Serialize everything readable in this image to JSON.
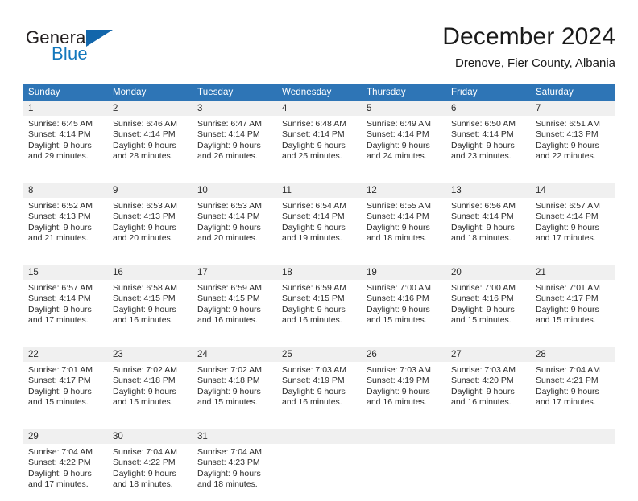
{
  "logo": {
    "text_top": "General",
    "text_bottom": "Blue",
    "triangle_icon": "blue-triangle-icon",
    "color_top": "#231f20",
    "color_bottom": "#1277bc",
    "color_triangle": "#1266ab"
  },
  "header": {
    "title": "December 2024",
    "subtitle": "Drenove, Fier County, Albania"
  },
  "theme": {
    "header_bg": "#2e75b6",
    "header_text": "#ffffff",
    "daynum_bg": "#f0f0f0",
    "row_divider": "#2e75b6",
    "body_text": "#2b2b2b"
  },
  "columns": [
    "Sunday",
    "Monday",
    "Tuesday",
    "Wednesday",
    "Thursday",
    "Friday",
    "Saturday"
  ],
  "weeks": [
    [
      {
        "day": "1",
        "sunrise": "Sunrise: 6:45 AM",
        "sunset": "Sunset: 4:14 PM",
        "daylight1": "Daylight: 9 hours",
        "daylight2": "and 29 minutes."
      },
      {
        "day": "2",
        "sunrise": "Sunrise: 6:46 AM",
        "sunset": "Sunset: 4:14 PM",
        "daylight1": "Daylight: 9 hours",
        "daylight2": "and 28 minutes."
      },
      {
        "day": "3",
        "sunrise": "Sunrise: 6:47 AM",
        "sunset": "Sunset: 4:14 PM",
        "daylight1": "Daylight: 9 hours",
        "daylight2": "and 26 minutes."
      },
      {
        "day": "4",
        "sunrise": "Sunrise: 6:48 AM",
        "sunset": "Sunset: 4:14 PM",
        "daylight1": "Daylight: 9 hours",
        "daylight2": "and 25 minutes."
      },
      {
        "day": "5",
        "sunrise": "Sunrise: 6:49 AM",
        "sunset": "Sunset: 4:14 PM",
        "daylight1": "Daylight: 9 hours",
        "daylight2": "and 24 minutes."
      },
      {
        "day": "6",
        "sunrise": "Sunrise: 6:50 AM",
        "sunset": "Sunset: 4:14 PM",
        "daylight1": "Daylight: 9 hours",
        "daylight2": "and 23 minutes."
      },
      {
        "day": "7",
        "sunrise": "Sunrise: 6:51 AM",
        "sunset": "Sunset: 4:13 PM",
        "daylight1": "Daylight: 9 hours",
        "daylight2": "and 22 minutes."
      }
    ],
    [
      {
        "day": "8",
        "sunrise": "Sunrise: 6:52 AM",
        "sunset": "Sunset: 4:13 PM",
        "daylight1": "Daylight: 9 hours",
        "daylight2": "and 21 minutes."
      },
      {
        "day": "9",
        "sunrise": "Sunrise: 6:53 AM",
        "sunset": "Sunset: 4:13 PM",
        "daylight1": "Daylight: 9 hours",
        "daylight2": "and 20 minutes."
      },
      {
        "day": "10",
        "sunrise": "Sunrise: 6:53 AM",
        "sunset": "Sunset: 4:14 PM",
        "daylight1": "Daylight: 9 hours",
        "daylight2": "and 20 minutes."
      },
      {
        "day": "11",
        "sunrise": "Sunrise: 6:54 AM",
        "sunset": "Sunset: 4:14 PM",
        "daylight1": "Daylight: 9 hours",
        "daylight2": "and 19 minutes."
      },
      {
        "day": "12",
        "sunrise": "Sunrise: 6:55 AM",
        "sunset": "Sunset: 4:14 PM",
        "daylight1": "Daylight: 9 hours",
        "daylight2": "and 18 minutes."
      },
      {
        "day": "13",
        "sunrise": "Sunrise: 6:56 AM",
        "sunset": "Sunset: 4:14 PM",
        "daylight1": "Daylight: 9 hours",
        "daylight2": "and 18 minutes."
      },
      {
        "day": "14",
        "sunrise": "Sunrise: 6:57 AM",
        "sunset": "Sunset: 4:14 PM",
        "daylight1": "Daylight: 9 hours",
        "daylight2": "and 17 minutes."
      }
    ],
    [
      {
        "day": "15",
        "sunrise": "Sunrise: 6:57 AM",
        "sunset": "Sunset: 4:14 PM",
        "daylight1": "Daylight: 9 hours",
        "daylight2": "and 17 minutes."
      },
      {
        "day": "16",
        "sunrise": "Sunrise: 6:58 AM",
        "sunset": "Sunset: 4:15 PM",
        "daylight1": "Daylight: 9 hours",
        "daylight2": "and 16 minutes."
      },
      {
        "day": "17",
        "sunrise": "Sunrise: 6:59 AM",
        "sunset": "Sunset: 4:15 PM",
        "daylight1": "Daylight: 9 hours",
        "daylight2": "and 16 minutes."
      },
      {
        "day": "18",
        "sunrise": "Sunrise: 6:59 AM",
        "sunset": "Sunset: 4:15 PM",
        "daylight1": "Daylight: 9 hours",
        "daylight2": "and 16 minutes."
      },
      {
        "day": "19",
        "sunrise": "Sunrise: 7:00 AM",
        "sunset": "Sunset: 4:16 PM",
        "daylight1": "Daylight: 9 hours",
        "daylight2": "and 15 minutes."
      },
      {
        "day": "20",
        "sunrise": "Sunrise: 7:00 AM",
        "sunset": "Sunset: 4:16 PM",
        "daylight1": "Daylight: 9 hours",
        "daylight2": "and 15 minutes."
      },
      {
        "day": "21",
        "sunrise": "Sunrise: 7:01 AM",
        "sunset": "Sunset: 4:17 PM",
        "daylight1": "Daylight: 9 hours",
        "daylight2": "and 15 minutes."
      }
    ],
    [
      {
        "day": "22",
        "sunrise": "Sunrise: 7:01 AM",
        "sunset": "Sunset: 4:17 PM",
        "daylight1": "Daylight: 9 hours",
        "daylight2": "and 15 minutes."
      },
      {
        "day": "23",
        "sunrise": "Sunrise: 7:02 AM",
        "sunset": "Sunset: 4:18 PM",
        "daylight1": "Daylight: 9 hours",
        "daylight2": "and 15 minutes."
      },
      {
        "day": "24",
        "sunrise": "Sunrise: 7:02 AM",
        "sunset": "Sunset: 4:18 PM",
        "daylight1": "Daylight: 9 hours",
        "daylight2": "and 15 minutes."
      },
      {
        "day": "25",
        "sunrise": "Sunrise: 7:03 AM",
        "sunset": "Sunset: 4:19 PM",
        "daylight1": "Daylight: 9 hours",
        "daylight2": "and 16 minutes."
      },
      {
        "day": "26",
        "sunrise": "Sunrise: 7:03 AM",
        "sunset": "Sunset: 4:19 PM",
        "daylight1": "Daylight: 9 hours",
        "daylight2": "and 16 minutes."
      },
      {
        "day": "27",
        "sunrise": "Sunrise: 7:03 AM",
        "sunset": "Sunset: 4:20 PM",
        "daylight1": "Daylight: 9 hours",
        "daylight2": "and 16 minutes."
      },
      {
        "day": "28",
        "sunrise": "Sunrise: 7:04 AM",
        "sunset": "Sunset: 4:21 PM",
        "daylight1": "Daylight: 9 hours",
        "daylight2": "and 17 minutes."
      }
    ],
    [
      {
        "day": "29",
        "sunrise": "Sunrise: 7:04 AM",
        "sunset": "Sunset: 4:22 PM",
        "daylight1": "Daylight: 9 hours",
        "daylight2": "and 17 minutes."
      },
      {
        "day": "30",
        "sunrise": "Sunrise: 7:04 AM",
        "sunset": "Sunset: 4:22 PM",
        "daylight1": "Daylight: 9 hours",
        "daylight2": "and 18 minutes."
      },
      {
        "day": "31",
        "sunrise": "Sunrise: 7:04 AM",
        "sunset": "Sunset: 4:23 PM",
        "daylight1": "Daylight: 9 hours",
        "daylight2": "and 18 minutes."
      },
      {
        "day": "",
        "sunrise": "",
        "sunset": "",
        "daylight1": "",
        "daylight2": ""
      },
      {
        "day": "",
        "sunrise": "",
        "sunset": "",
        "daylight1": "",
        "daylight2": ""
      },
      {
        "day": "",
        "sunrise": "",
        "sunset": "",
        "daylight1": "",
        "daylight2": ""
      },
      {
        "day": "",
        "sunrise": "",
        "sunset": "",
        "daylight1": "",
        "daylight2": ""
      }
    ]
  ]
}
